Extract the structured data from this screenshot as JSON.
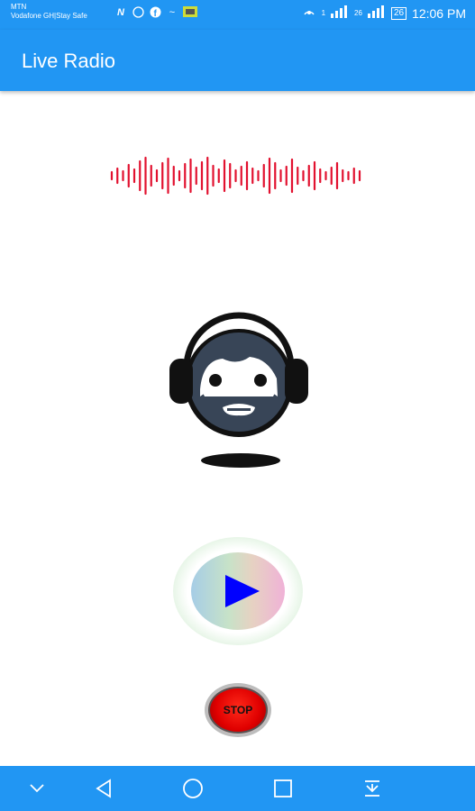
{
  "statusbar": {
    "carrier_line1": "MTN",
    "carrier_line2": "Vodafone GH|Stay Safe",
    "notif_icons": [
      "n-icon",
      "whatsapp-icon",
      "facebook-icon",
      "tilde-icon",
      "image-icon"
    ],
    "network_labels": [
      "1",
      "26"
    ],
    "battery": "26",
    "time": "12:06 PM"
  },
  "appbar": {
    "title": "Live Radio"
  },
  "controls": {
    "stop_label": "STOP"
  },
  "colors": {
    "primary": "#2196f3",
    "wave": "#e2112f",
    "play_icon": "#0000ff",
    "stop": "#ff0000"
  }
}
